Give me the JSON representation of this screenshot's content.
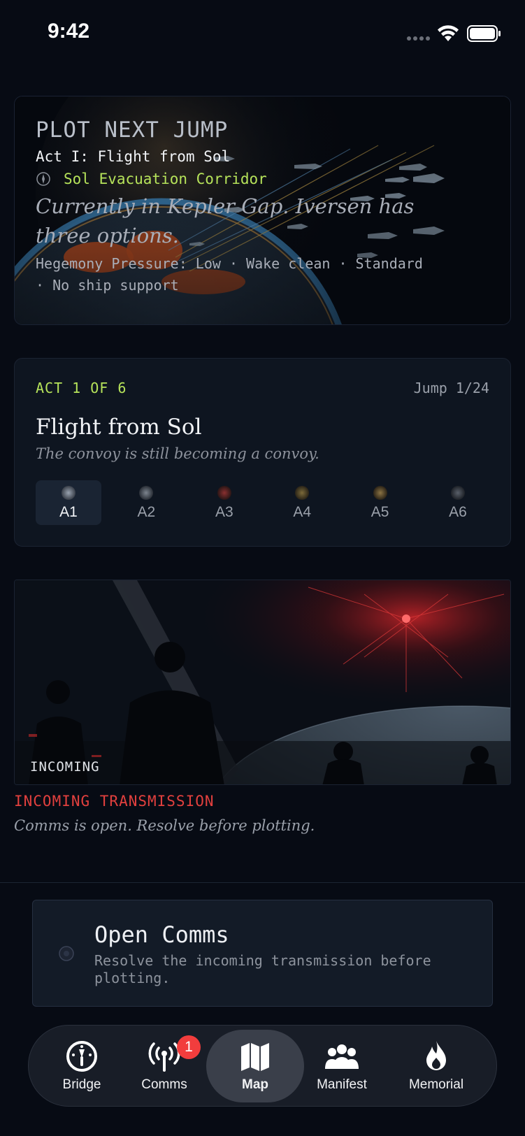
{
  "status_bar": {
    "time": "9:42"
  },
  "hero": {
    "heading": "PLOT NEXT JUMP",
    "act": "Act I: Flight from Sol",
    "location": "Sol Evacuation Corridor",
    "description": "Currently in Kepler Gap. Iversen has three options.",
    "meta": "Hegemony Pressure: Low · Wake clean · Standard · No ship support"
  },
  "act_card": {
    "label": "ACT 1 OF 6",
    "jump": "Jump 1/24",
    "title": "Flight from Sol",
    "subtitle": "The convoy is still becoming a convoy.",
    "tabs": [
      {
        "label": "A1",
        "active": true,
        "color": "#6d7480"
      },
      {
        "label": "A2",
        "active": false,
        "color": "#5b626c"
      },
      {
        "label": "A3",
        "active": false,
        "color": "#6a2a2a"
      },
      {
        "label": "A4",
        "active": false,
        "color": "#5c5030"
      },
      {
        "label": "A5",
        "active": false,
        "color": "#6a5a36"
      },
      {
        "label": "A6",
        "active": false,
        "color": "#3a3f48"
      }
    ]
  },
  "transmission": {
    "tag": "INCOMING",
    "title": "INCOMING TRANSMISSION",
    "subtitle": "Comms is open. Resolve before plotting."
  },
  "open_comms": {
    "title": "Open Comms",
    "subtitle": "Resolve the incoming transmission before plotting."
  },
  "tabbar": {
    "tabs": [
      {
        "label": "Bridge",
        "icon": "gauge-icon"
      },
      {
        "label": "Comms",
        "icon": "antenna-icon",
        "badge": "1"
      },
      {
        "label": "Map",
        "icon": "map-icon",
        "selected": true
      },
      {
        "label": "Manifest",
        "icon": "people-icon"
      },
      {
        "label": "Memorial",
        "icon": "flame-icon"
      }
    ]
  },
  "colors": {
    "background": "#070b14",
    "accent_green": "#b6e35a",
    "alert_red": "#e2403e",
    "badge_red": "#f23d3d"
  }
}
